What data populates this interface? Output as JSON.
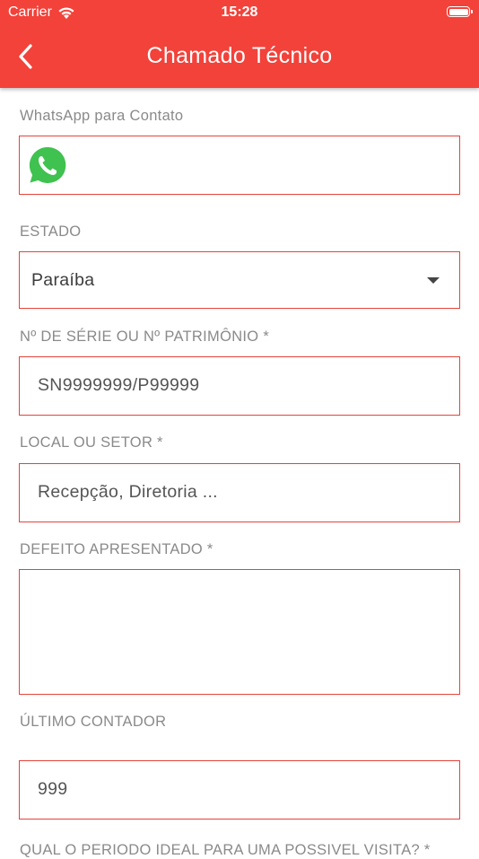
{
  "status_bar": {
    "carrier": "Carrier",
    "time": "15:28"
  },
  "header": {
    "title": "Chamado Técnico"
  },
  "colors": {
    "brand": "#f2423a",
    "field_border": "#e3443c",
    "label": "#8a8a8a"
  },
  "form": {
    "whatsapp": {
      "label": "WhatsApp para Contato",
      "icon": "whatsapp-icon",
      "value": ""
    },
    "estado": {
      "label": "ESTADO",
      "value": "Paraíba"
    },
    "serie": {
      "label": "Nº DE SÉRIE OU Nº PATRIMÔNIO *",
      "placeholder": "SN9999999/P99999"
    },
    "local": {
      "label": "LOCAL OU SETOR *",
      "placeholder": "Recepção, Diretoria ..."
    },
    "defeito": {
      "label": "DEFEITO APRESENTADO *",
      "value": ""
    },
    "contador": {
      "label": "ÚLTIMO CONTADOR",
      "placeholder": "999"
    },
    "periodo": {
      "label": "QUAL O PERIODO IDEAL PARA UMA POSSIVEL VISITA? *"
    }
  }
}
